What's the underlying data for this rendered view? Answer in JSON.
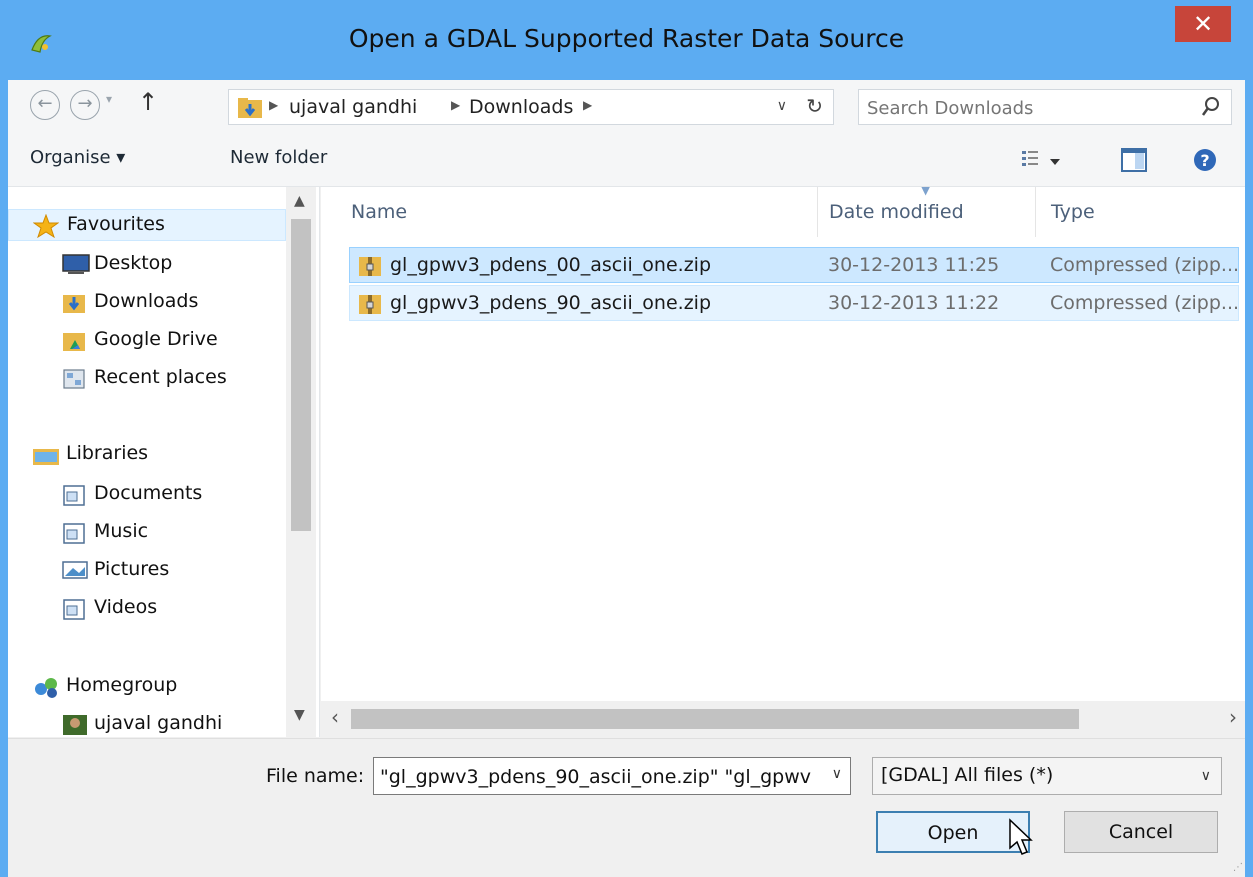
{
  "window": {
    "title": "Open a GDAL Supported Raster Data Source",
    "close_label": "✕"
  },
  "address": {
    "crumbs": [
      "ujaval gandhi",
      "Downloads"
    ]
  },
  "search": {
    "placeholder": "Search Downloads"
  },
  "toolbar": {
    "organise_label": "Organise ▾",
    "new_folder_label": "New folder"
  },
  "nav": {
    "favourites": "Favourites",
    "desktop": "Desktop",
    "downloads": "Downloads",
    "google_drive": "Google Drive",
    "recent_places": "Recent places",
    "libraries": "Libraries",
    "documents": "Documents",
    "music": "Music",
    "pictures": "Pictures",
    "videos": "Videos",
    "homegroup": "Homegroup",
    "user": "ujaval gandhi"
  },
  "columns": {
    "name": "Name",
    "date_modified": "Date modified",
    "type": "Type"
  },
  "files": [
    {
      "name": "gl_gpwv3_pdens_00_ascii_one.zip",
      "date": "30-12-2013 11:25",
      "type": "Compressed (zipp..."
    },
    {
      "name": "gl_gpwv3_pdens_90_ascii_one.zip",
      "date": "30-12-2013 11:22",
      "type": "Compressed (zipp..."
    }
  ],
  "file_name": {
    "label": "File name:",
    "value": "\"gl_gpwv3_pdens_90_ascii_one.zip\" \"gl_gpwv"
  },
  "filter": {
    "value": "[GDAL] All files (*)"
  },
  "buttons": {
    "open": "Open",
    "cancel": "Cancel"
  },
  "colors": {
    "titlebar": "#5cacf2",
    "close": "#c7453a",
    "selection": "#cde8ff"
  }
}
